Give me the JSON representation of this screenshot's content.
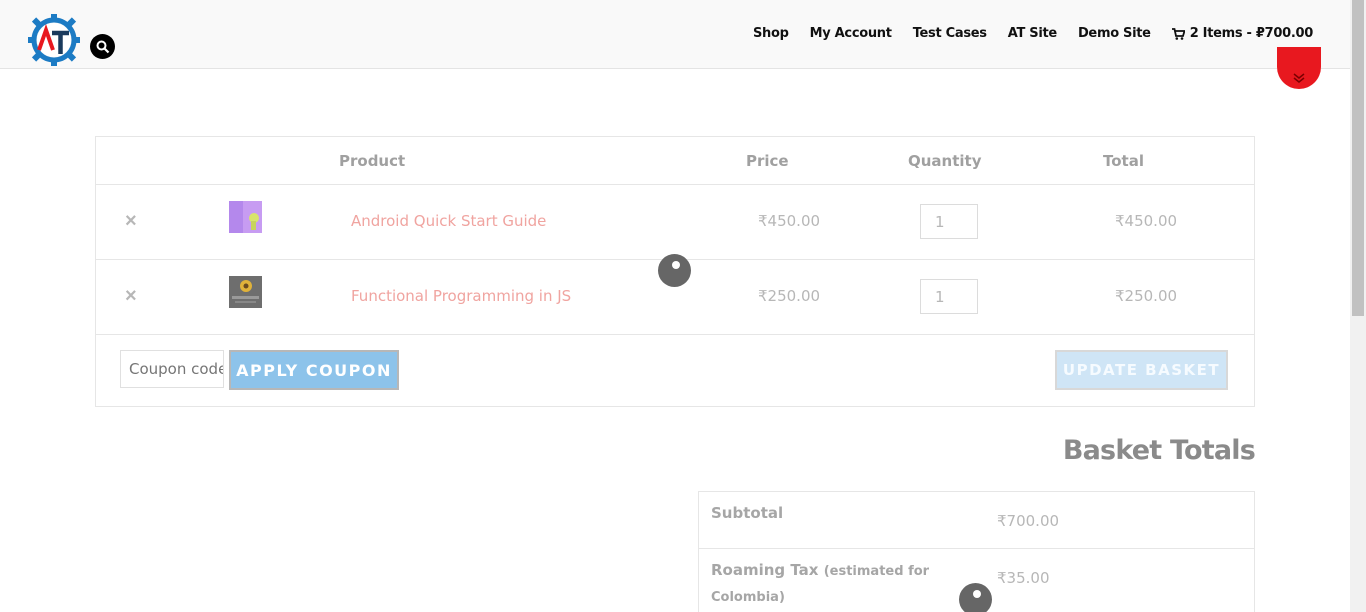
{
  "header": {
    "logo_alt": "AT",
    "nav": [
      "Shop",
      "My Account",
      "Test Cases",
      "AT Site",
      "Demo Site"
    ],
    "cart_label": "2 Items - ₽700.00"
  },
  "cart": {
    "headers": {
      "product": "Product",
      "price": "Price",
      "quantity": "Quantity",
      "total": "Total"
    },
    "items": [
      {
        "remove": "×",
        "name": "Android Quick Start Guide",
        "price": "₹450.00",
        "qty": "1",
        "total": "₹450.00"
      },
      {
        "remove": "×",
        "name": "Functional Programming in JS",
        "price": "₹250.00",
        "qty": "1",
        "total": "₹250.00"
      }
    ],
    "coupon_placeholder": "Coupon code",
    "apply_label": "APPLY COUPON",
    "update_label": "UPDATE BASKET"
  },
  "totals": {
    "title": "Basket Totals",
    "subtotal_label": "Subtotal",
    "subtotal_value": "₹700.00",
    "tax_label": "Roaming Tax",
    "tax_note": "(estimated for Colombia)",
    "tax_value": "₹35.00"
  },
  "colors": {
    "accent_red": "#e8181f",
    "link": "#f0a4a0",
    "button_blue": "#8dc3ea"
  }
}
